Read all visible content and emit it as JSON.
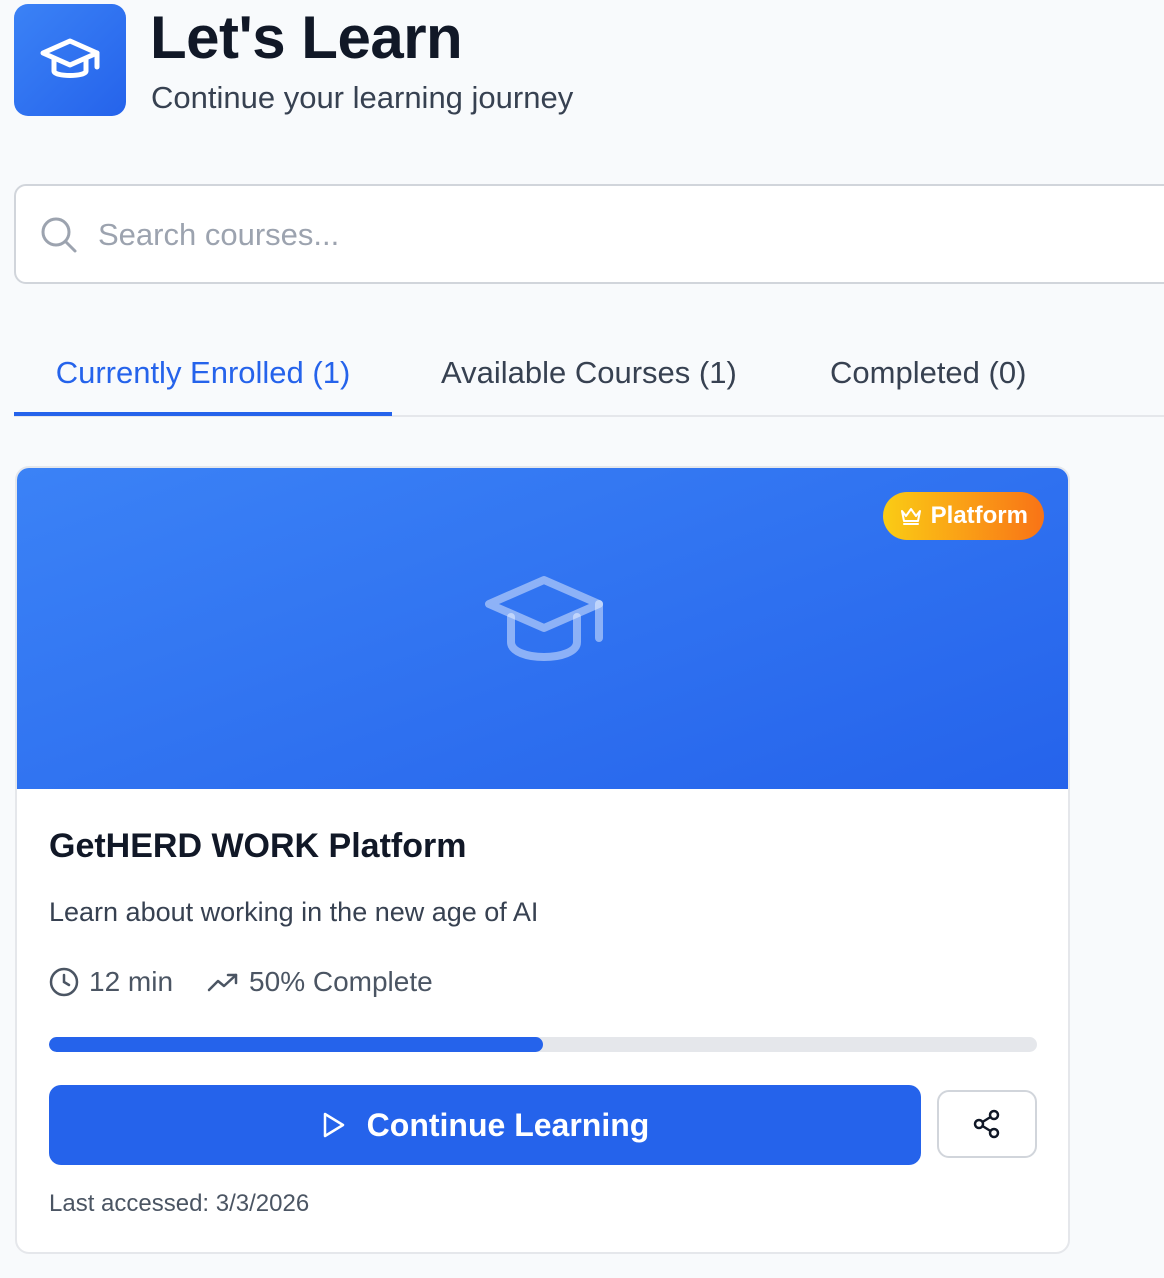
{
  "header": {
    "logo_icon": "graduation-cap-icon",
    "title": "Let's Learn",
    "subtitle": "Continue your learning journey"
  },
  "search": {
    "icon": "search-icon",
    "placeholder": "Search courses...",
    "value": ""
  },
  "tabs": [
    {
      "label": "Currently Enrolled (1)",
      "active": true
    },
    {
      "label": "Available Courses (1)",
      "active": false
    },
    {
      "label": "Completed (0)",
      "active": false
    }
  ],
  "course": {
    "banner_icon": "graduation-cap-icon",
    "badge": {
      "icon": "crown-icon",
      "label": "Platform"
    },
    "title": "GetHERD WORK Platform",
    "description": "Learn about working in the new age of AI",
    "duration": "12 min",
    "progress_text": "50% Complete",
    "progress_value": 0.5,
    "continue_label": "Continue Learning",
    "share_icon": "share-icon",
    "last_accessed": "Last accessed: 3/3/2026"
  },
  "colors": {
    "accent": "#2563eb",
    "banner_start": "#3b82f6",
    "badge_start": "#facc15",
    "badge_end": "#f97316"
  }
}
